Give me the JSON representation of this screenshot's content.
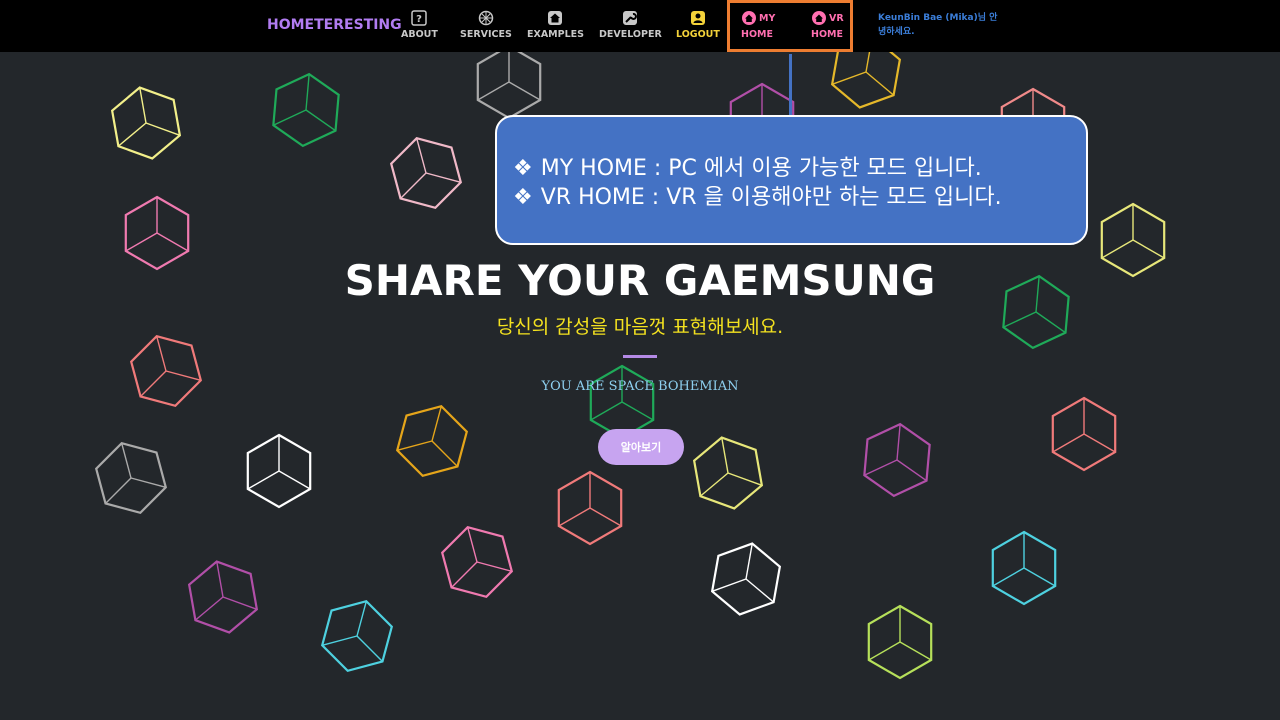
{
  "nav": {
    "brand": "HOMETERESTING",
    "items": [
      {
        "label": "ABOUT",
        "icon": "question-icon"
      },
      {
        "label": "SERVICES",
        "icon": "services-icon"
      },
      {
        "label": "EXAMPLES",
        "icon": "home-icon"
      },
      {
        "label": "DEVELOPER",
        "icon": "wrench-icon"
      },
      {
        "label": "LOGOUT",
        "icon": "user-icon"
      }
    ],
    "my_home": {
      "line1": "MY",
      "line2": "HOME",
      "icon": "home-icon"
    },
    "vr_home": {
      "line1": "VR",
      "line2": "HOME",
      "icon": "home-icon"
    },
    "greeting": "KeunBin Bae (Mika)님 안녕하세요."
  },
  "callout": {
    "bullet": "❖",
    "lines": [
      "MY HOME : PC 에서 이용 가능한 모드 입니다.",
      "VR HOME : VR 을 이용해야만 하는 모드 입니다."
    ]
  },
  "hero": {
    "title": "SHARE YOUR GAEMSUNG",
    "subtitle": "당신의 감성을 마음껏 표현해보세요.",
    "tagline": "YOU ARE SPACE BOHEMIAN",
    "button": "알아보기"
  },
  "colors": {
    "background": "#23272b",
    "brand": "#b17cf1",
    "logout": "#f3d23a",
    "home": "#ff6fb0",
    "highlight": "#ed7d31",
    "callout": "#4472c4",
    "subtitle": "#f3e11f",
    "tagline": "#8ed0f0",
    "button": "#c7a4f0"
  }
}
